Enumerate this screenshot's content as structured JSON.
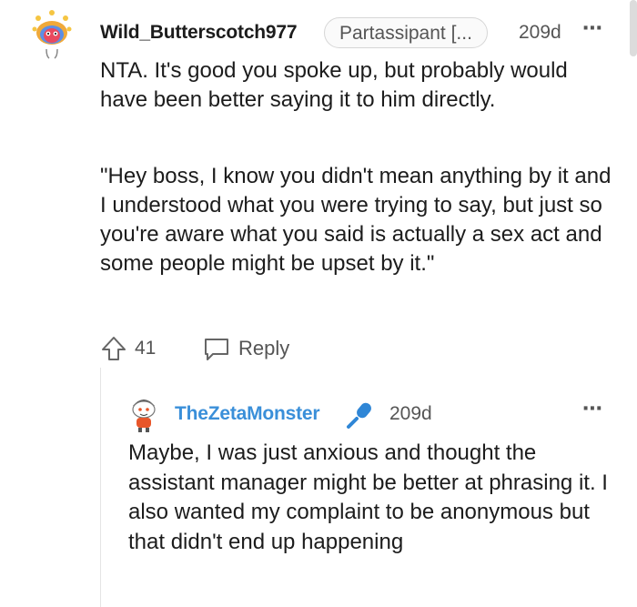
{
  "comment": {
    "author": "Wild_Butterscotch977",
    "flair": "Partassipant [...",
    "age": "209d",
    "more_icon": "⋯",
    "paragraphs": [
      "NTA. It's good you spoke up, but probably would have been better saying it to him directly.",
      "\"Hey boss, I know you didn't mean anything by it and I understood what you were trying to say, but just so you're aware what you said is actually a sex act and some people might be upset by it.\""
    ],
    "votes": "41",
    "reply_label": "Reply"
  },
  "reply": {
    "author": "TheZetaMonster",
    "author_color": "#3a8fd9",
    "age": "209d",
    "more_icon": "⋯",
    "text": "Maybe, I was just anxious and thought the assistant manager might be better at phrasing it. I also wanted my complaint to be anonymous but that didn't end up happening"
  }
}
